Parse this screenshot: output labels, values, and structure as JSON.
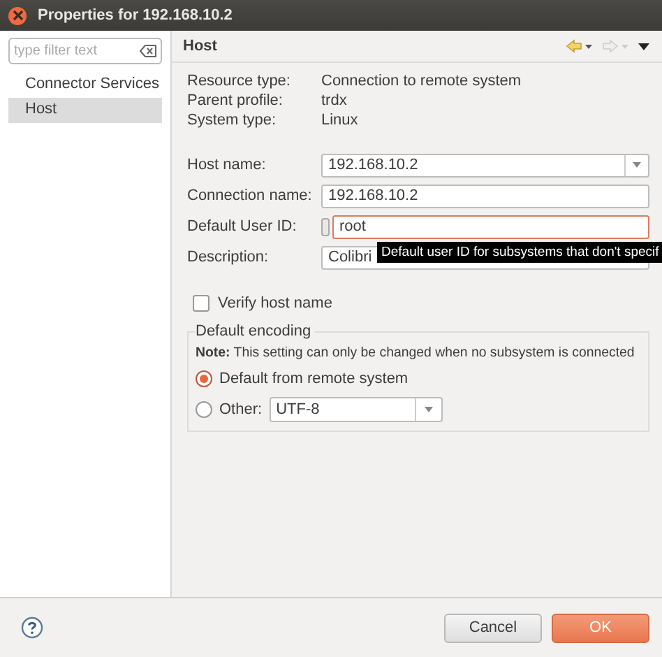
{
  "window": {
    "title": "Properties for 192.168.10.2"
  },
  "sidebar": {
    "filter": {
      "placeholder": "type filter text"
    },
    "items": [
      {
        "label": "Connector Services",
        "selected": false
      },
      {
        "label": "Host",
        "selected": true
      }
    ]
  },
  "page": {
    "title": "Host",
    "info": [
      {
        "label": "Resource type:",
        "value": "Connection to remote system"
      },
      {
        "label": "Parent profile:",
        "value": "trdx"
      },
      {
        "label": "System type:",
        "value": "Linux"
      }
    ],
    "fields": [
      {
        "kind": "combo",
        "label": "Host name:",
        "value": "192.168.10.2",
        "focused": false
      },
      {
        "kind": "text",
        "label": "Connection name:",
        "value": "192.168.10.2",
        "focused": false
      },
      {
        "kind": "info-text",
        "label": "Default User ID:",
        "value": "root",
        "focused": true
      },
      {
        "kind": "text",
        "label": "Description:",
        "value": "Colibri",
        "focused": false
      }
    ],
    "tooltip": "Default user ID for subsystems that don't specif",
    "verify": {
      "label": "Verify host name",
      "checked": false
    },
    "encoding": {
      "title": "Default encoding",
      "note": "**Note:** This setting can only be changed when no subsystem is connected",
      "options": [
        {
          "kind": "plain",
          "label": "Default from remote system",
          "selected": true
        },
        {
          "kind": "combo",
          "label": "Other:",
          "value": "UTF-8",
          "selected": false
        }
      ]
    }
  },
  "buttons": [
    {
      "label": "Cancel",
      "kind": "secondary"
    },
    {
      "label": "OK",
      "kind": "primary"
    }
  ]
}
